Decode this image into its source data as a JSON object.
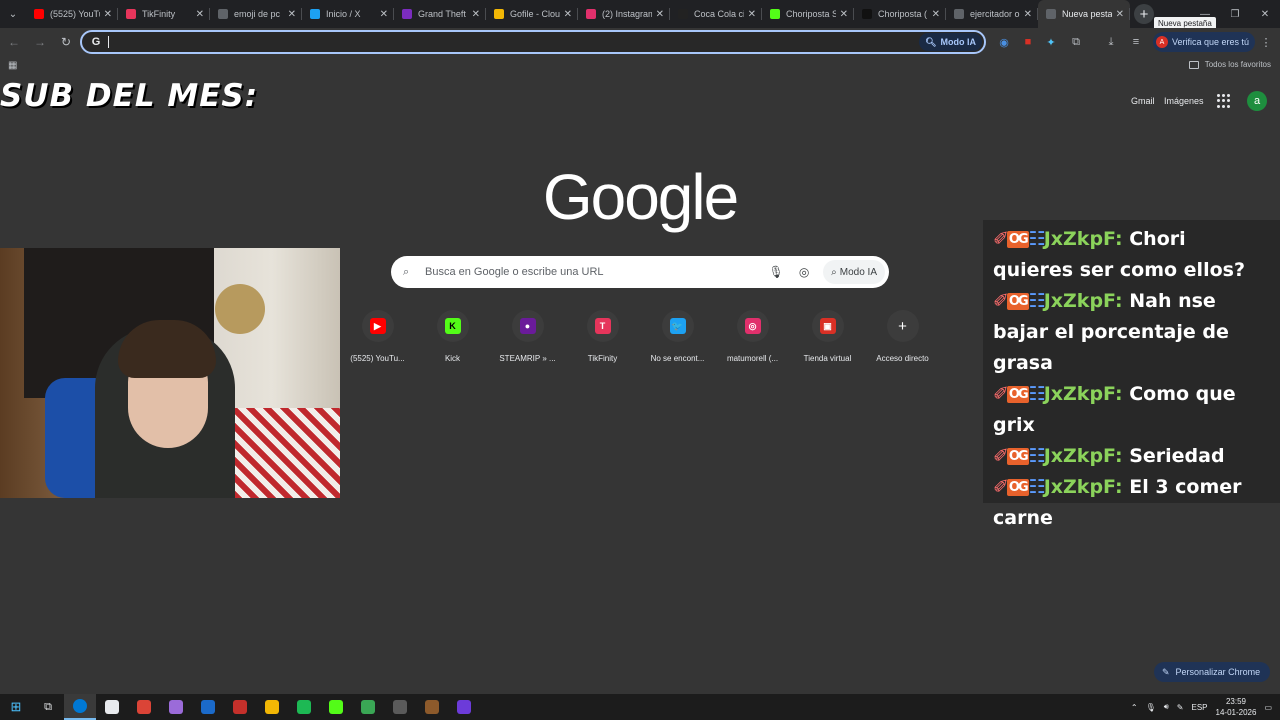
{
  "tabs": [
    {
      "title": "(5525) YouTube",
      "color": "#ff0000"
    },
    {
      "title": "TikFinity",
      "color": "#e6355b"
    },
    {
      "title": "emoji de pc",
      "color": "#5f6368"
    },
    {
      "title": "Inicio / X",
      "color": "#1da1f2"
    },
    {
      "title": "Grand Theft",
      "color": "#7b2cbf"
    },
    {
      "title": "Gofile - Clou",
      "color": "#f2b705"
    },
    {
      "title": "(2) Instagram",
      "color": "#e1306c"
    },
    {
      "title": "Coca Cola ci",
      "color": "#222222"
    },
    {
      "title": "Choriposta S",
      "color": "#53fc18"
    },
    {
      "title": "Choriposta (",
      "color": "#111111"
    },
    {
      "title": "ejercitador o",
      "color": "#5f6368"
    },
    {
      "title": "Nueva pesta",
      "color": "#5f6368",
      "active": true
    }
  ],
  "tooltip": "Nueva pestaña",
  "omnibox": {
    "value": "",
    "modo_ia": "Modo IA"
  },
  "verify": {
    "avatar": "A",
    "label": "Verifica que eres tú"
  },
  "bookmarks": {
    "all": "Todos los favoritos"
  },
  "overlay_title": "SUB DEL MES:",
  "header": {
    "gmail": "Gmail",
    "images": "Imágenes",
    "account": "a"
  },
  "logo": "Google",
  "search": {
    "placeholder": "Busca en Google o escribe una URL",
    "modo_ia": "Modo IA"
  },
  "shortcuts": [
    {
      "label": "(5525) YouTu...",
      "icon": "youtube-icon",
      "glyph": "▶",
      "color": "#ff0000"
    },
    {
      "label": "Kick",
      "icon": "kick-icon",
      "glyph": "K",
      "color": "#53fc18"
    },
    {
      "label": "STEAMRIP » ...",
      "icon": "steamrip-icon",
      "glyph": "●",
      "color": "#6a1b9a"
    },
    {
      "label": "TikFinity",
      "icon": "tikfinity-icon",
      "glyph": "T",
      "color": "#e6355b"
    },
    {
      "label": "No se encont...",
      "icon": "twitter-icon",
      "glyph": "🐦",
      "color": "#1da1f2"
    },
    {
      "label": "matumorell (...",
      "icon": "instagram-icon",
      "glyph": "◎",
      "color": "#e1306c"
    },
    {
      "label": "Tienda virtual",
      "icon": "store-icon",
      "glyph": "▣",
      "color": "#d93025"
    },
    {
      "label": "Acceso directo",
      "icon": "add-icon",
      "glyph": "+",
      "color": "transparent"
    }
  ],
  "chat": {
    "badge_og": "OG",
    "messages": [
      {
        "user": "JxZkpF:",
        "text": "Chori quieres ser como ellos?"
      },
      {
        "user": "JxZkpF:",
        "text": "Nah nse bajar el porcentaje de grasa"
      },
      {
        "user": "JxZkpF:",
        "text": "Como que grix"
      },
      {
        "user": "JxZkpF:",
        "text": "Seriedad"
      },
      {
        "user": "JxZkpF:",
        "text": "El 3 comer carne"
      }
    ]
  },
  "customize": "Personalizar Chrome",
  "taskbar": {
    "apps": [
      "#0078d4",
      "#e8eaed",
      "#db4437",
      "#9b6bd9",
      "#1b6ac9",
      "#c4302b",
      "#f2b705",
      "#1db954",
      "#53fc18",
      "#3aa655",
      "#5a5a5a",
      "#8d5a2b",
      "#6c3bd9"
    ],
    "lang": "ESP",
    "time": "23:59",
    "date": "14-01-2026"
  }
}
